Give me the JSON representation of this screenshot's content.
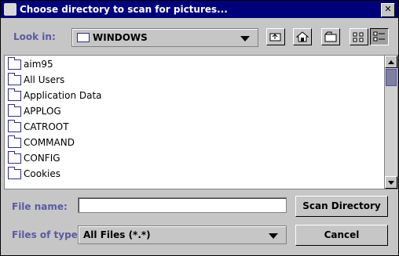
{
  "window": {
    "title": "Choose directory to scan for pictures..."
  },
  "lookin": {
    "label": "Look in:",
    "value": "WINDOWS"
  },
  "toolbar": {
    "up_icon": "up-folder-icon",
    "home_icon": "home-icon",
    "newfolder_icon": "new-folder-icon",
    "list_icon": "list-view-icon",
    "details_icon": "details-view-icon"
  },
  "files": [
    "aim95",
    "All Users",
    "Application Data",
    "APPLOG",
    "CATROOT",
    "COMMAND",
    "CONFIG",
    "Cookies"
  ],
  "filename": {
    "label": "File name:",
    "value": ""
  },
  "filetype": {
    "label": "Files of type:",
    "value": "All Files (*.*)"
  },
  "buttons": {
    "scan": "Scan Directory",
    "cancel": "Cancel"
  }
}
